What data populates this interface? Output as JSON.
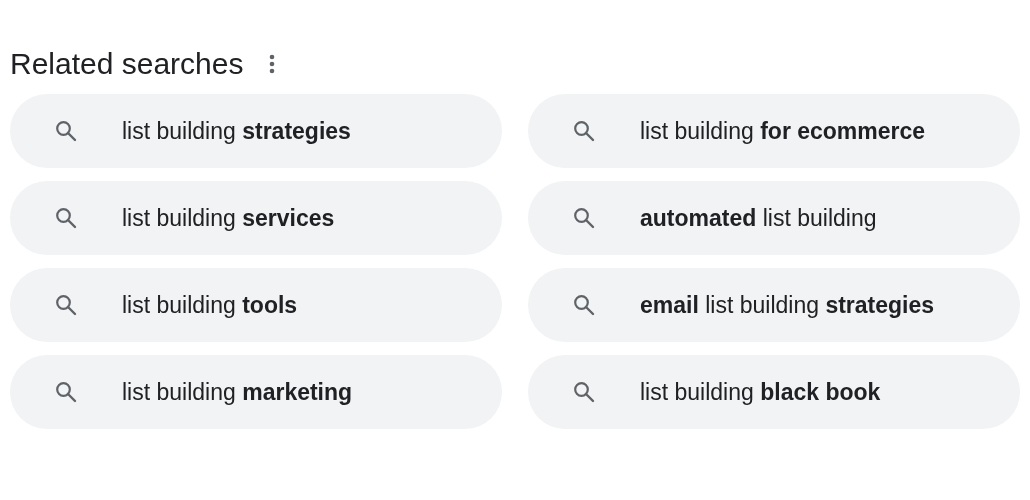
{
  "title": "Related searches",
  "items": [
    {
      "text": "list building **strategies**"
    },
    {
      "text": "list building **for ecommerce**"
    },
    {
      "text": "list building **services**"
    },
    {
      "text": "**automated** list building"
    },
    {
      "text": "list building **tools**"
    },
    {
      "text": "**email** list building **strategies**"
    },
    {
      "text": "list building **marketing**"
    },
    {
      "text": "list building **black book**"
    }
  ]
}
